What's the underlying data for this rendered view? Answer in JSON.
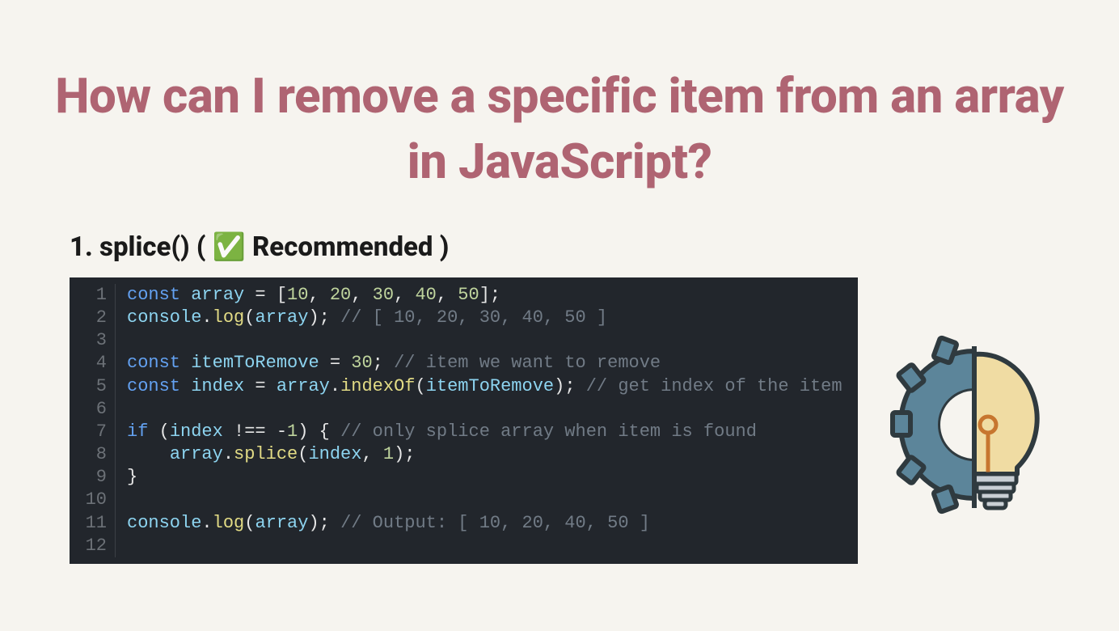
{
  "title": "How can I remove a specific item from an array in JavaScript?",
  "subheading": "1. splice() ( ✅ Recommended )",
  "code": {
    "line_numbers": [
      "1",
      "2",
      "3",
      "4",
      "5",
      "6",
      "7",
      "8",
      "9",
      "10",
      "11",
      "12"
    ],
    "lines": [
      [
        {
          "t": "const ",
          "c": "kw"
        },
        {
          "t": "array",
          "c": "ident"
        },
        {
          "t": " = ",
          "c": "op"
        },
        {
          "t": "[",
          "c": "pun"
        },
        {
          "t": "10",
          "c": "num"
        },
        {
          "t": ", ",
          "c": "pun"
        },
        {
          "t": "20",
          "c": "num"
        },
        {
          "t": ", ",
          "c": "pun"
        },
        {
          "t": "30",
          "c": "num"
        },
        {
          "t": ", ",
          "c": "pun"
        },
        {
          "t": "40",
          "c": "num"
        },
        {
          "t": ", ",
          "c": "pun"
        },
        {
          "t": "50",
          "c": "num"
        },
        {
          "t": "];",
          "c": "pun"
        }
      ],
      [
        {
          "t": "console",
          "c": "ident"
        },
        {
          "t": ".",
          "c": "pun"
        },
        {
          "t": "log",
          "c": "fn"
        },
        {
          "t": "(",
          "c": "pun"
        },
        {
          "t": "array",
          "c": "ident"
        },
        {
          "t": "); ",
          "c": "pun"
        },
        {
          "t": "// [ 10, 20, 30, 40, 50 ]",
          "c": "cmt"
        }
      ],
      [],
      [
        {
          "t": "const ",
          "c": "kw"
        },
        {
          "t": "itemToRemove",
          "c": "ident"
        },
        {
          "t": " = ",
          "c": "op"
        },
        {
          "t": "30",
          "c": "num"
        },
        {
          "t": "; ",
          "c": "pun"
        },
        {
          "t": "// item we want to remove",
          "c": "cmt"
        }
      ],
      [
        {
          "t": "const ",
          "c": "kw"
        },
        {
          "t": "index",
          "c": "ident"
        },
        {
          "t": " = ",
          "c": "op"
        },
        {
          "t": "array",
          "c": "ident"
        },
        {
          "t": ".",
          "c": "pun"
        },
        {
          "t": "indexOf",
          "c": "fn"
        },
        {
          "t": "(",
          "c": "pun"
        },
        {
          "t": "itemToRemove",
          "c": "ident"
        },
        {
          "t": "); ",
          "c": "pun"
        },
        {
          "t": "// get index of the item",
          "c": "cmt"
        }
      ],
      [],
      [
        {
          "t": "if ",
          "c": "kw"
        },
        {
          "t": "(",
          "c": "pun"
        },
        {
          "t": "index",
          "c": "ident"
        },
        {
          "t": " !== ",
          "c": "op"
        },
        {
          "t": "-",
          "c": "op"
        },
        {
          "t": "1",
          "c": "num"
        },
        {
          "t": ") { ",
          "c": "pun"
        },
        {
          "t": "// only splice array when item is found",
          "c": "cmt"
        }
      ],
      [
        {
          "t": "    ",
          "c": "pun"
        },
        {
          "t": "array",
          "c": "ident"
        },
        {
          "t": ".",
          "c": "pun"
        },
        {
          "t": "splice",
          "c": "fn"
        },
        {
          "t": "(",
          "c": "pun"
        },
        {
          "t": "index",
          "c": "ident"
        },
        {
          "t": ", ",
          "c": "pun"
        },
        {
          "t": "1",
          "c": "num"
        },
        {
          "t": ");",
          "c": "pun"
        }
      ],
      [
        {
          "t": "}",
          "c": "pun"
        }
      ],
      [],
      [
        {
          "t": "console",
          "c": "ident"
        },
        {
          "t": ".",
          "c": "pun"
        },
        {
          "t": "log",
          "c": "fn"
        },
        {
          "t": "(",
          "c": "pun"
        },
        {
          "t": "array",
          "c": "ident"
        },
        {
          "t": "); ",
          "c": "pun"
        },
        {
          "t": "// Output: [ 10, 20, 40, 50 ]",
          "c": "cmt"
        }
      ],
      []
    ]
  }
}
